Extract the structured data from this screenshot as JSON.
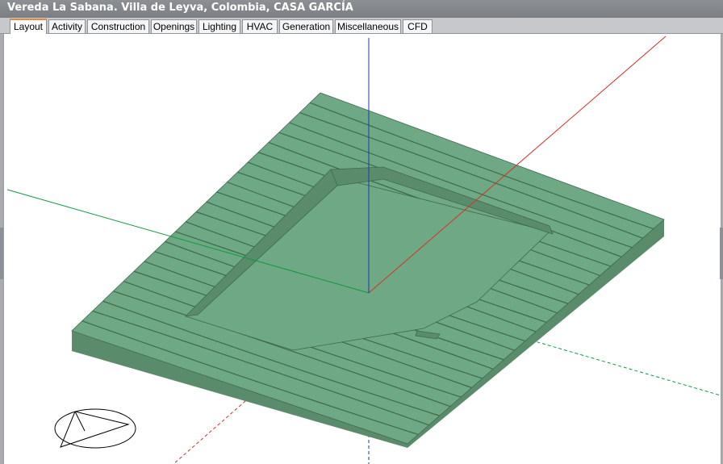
{
  "window": {
    "title": "Vereda La Sabana. Villa de Leyva, Colombia, CASA GARCÍA"
  },
  "tabs": [
    {
      "label": "Layout",
      "active": true
    },
    {
      "label": "Activity",
      "active": false
    },
    {
      "label": "Construction",
      "active": false
    },
    {
      "label": "Openings",
      "active": false
    },
    {
      "label": "Lighting",
      "active": false
    },
    {
      "label": "HVAC",
      "active": false
    },
    {
      "label": "Generation",
      "active": false
    },
    {
      "label": "Miscellaneous",
      "active": false
    },
    {
      "label": "CFD",
      "active": false
    }
  ],
  "colors": {
    "terrain_top": "#6fa884",
    "terrain_side": "#5a8c6c",
    "contour": "#3e6a4e",
    "x_axis": "#d9302a",
    "y_axis": "#0f9a3d",
    "z_axis": "#1c3aa8",
    "tab_accent": "#e8873d"
  },
  "icons": {
    "compass": "north-compass-icon"
  }
}
